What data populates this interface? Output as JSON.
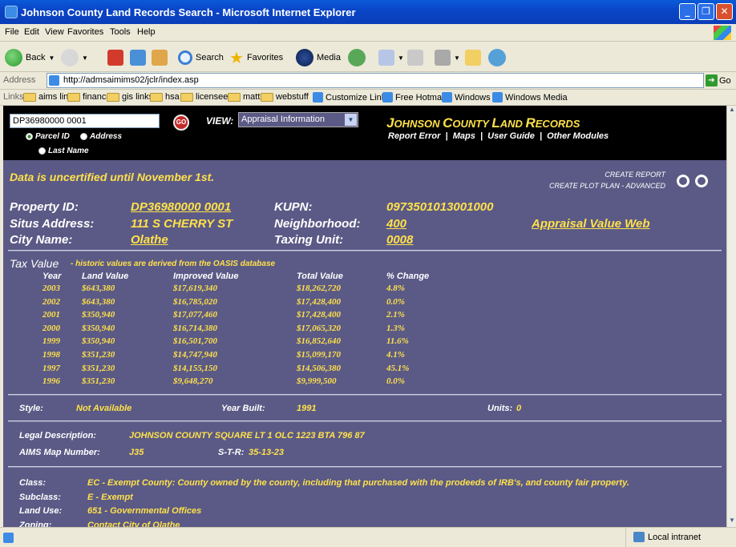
{
  "window": {
    "title": "Johnson County Land Records Search - Microsoft Internet Explorer"
  },
  "menu": [
    "File",
    "Edit",
    "View",
    "Favorites",
    "Tools",
    "Help"
  ],
  "toolbar": {
    "back": "Back",
    "search": "Search",
    "favorites": "Favorites",
    "media": "Media"
  },
  "address": {
    "label": "Address",
    "url": "http://admsaimims02/jclr/index.asp",
    "go": "Go"
  },
  "links": {
    "label": "Links",
    "items": [
      "aims links",
      "finance",
      "gis links",
      "hsa",
      "licensee",
      "matt",
      "webstuff",
      "Customize Links",
      "Free Hotmail",
      "Windows",
      "Windows Media"
    ]
  },
  "search": {
    "parcel_value": "DP36980000 0001",
    "go_label": "GO",
    "radios": [
      "Parcel ID",
      "Address",
      "Last Name"
    ],
    "view_label": "VIEW:",
    "view_selected": "Appraisal Information"
  },
  "brand": {
    "parts": [
      "J",
      "OHNSON ",
      "C",
      "OUNTY ",
      "L",
      "AND ",
      "R",
      "ECORDS"
    ],
    "links": [
      "Report Error",
      "Maps",
      "User Guide",
      "Other Modules"
    ]
  },
  "notice": "Data is uncertified until November 1st.",
  "actions": {
    "create_report": "CREATE REPORT",
    "create_plot_plan": "CREATE PLOT PLAN - ADVANCED"
  },
  "property": {
    "id_label": "Property ID:",
    "id_value": "DP36980000 0001",
    "situs_label": "Situs Address:",
    "situs_value": "111 S CHERRY ST",
    "city_label": "City Name:",
    "city_value": "Olathe",
    "kupn_label": "KUPN:",
    "kupn_value": "0973501013001000",
    "neighborhood_label": "Neighborhood:",
    "neighborhood_value": "400",
    "taxing_label": "Taxing Unit:",
    "taxing_value": "0008",
    "appraisal_link": "Appraisal Value Web"
  },
  "tax": {
    "title": "Tax Value",
    "subtitle": "- historic values are derived from the OASIS database",
    "headers": [
      "Year",
      "Land Value",
      "Improved Value",
      "Total Value",
      "% Change"
    ],
    "rows": [
      [
        "2003",
        "$643,380",
        "$17,619,340",
        "$18,262,720",
        "4.8%"
      ],
      [
        "2002",
        "$643,380",
        "$16,785,020",
        "$17,428,400",
        "0.0%"
      ],
      [
        "2001",
        "$350,940",
        "$17,077,460",
        "$17,428,400",
        "2.1%"
      ],
      [
        "2000",
        "$350,940",
        "$16,714,380",
        "$17,065,320",
        "1.3%"
      ],
      [
        "1999",
        "$350,940",
        "$16,501,700",
        "$16,852,640",
        "11.6%"
      ],
      [
        "1998",
        "$351,230",
        "$14,747,940",
        "$15,099,170",
        "4.1%"
      ],
      [
        "1997",
        "$351,230",
        "$14,155,150",
        "$14,506,380",
        "45.1%"
      ],
      [
        "1996",
        "$351,230",
        "$9,648,270",
        "$9,999,500",
        "0.0%"
      ]
    ]
  },
  "building": {
    "style_label": "Style:",
    "style_value": "Not Available",
    "year_label": "Year Built:",
    "year_value": "1991",
    "units_label": "Units:",
    "units_value": "0"
  },
  "legal": {
    "desc_label": "Legal Description:",
    "desc_value": "JOHNSON COUNTY SQUARE LT 1 OLC 1223 BTA 796 87",
    "map_label": "AIMS Map Number:",
    "map_value": "J35",
    "str_label": "S-T-R:",
    "str_value": "35-13-23"
  },
  "classification": {
    "class_label": "Class:",
    "class_value": "EC - Exempt County: County owned by the county, including that purchased with the prodeeds of IRB's, and county fair property.",
    "subclass_label": "Subclass:",
    "subclass_value": "E - Exempt",
    "landuse_label": "Land Use:",
    "landuse_value": "651 - Governmental Offices",
    "zoning_label": "Zoning:",
    "zoning_value": "Contact City of Olathe"
  },
  "status": {
    "zone": "Local intranet"
  },
  "colors": {
    "content_bg": "#5b5a86",
    "accent_yellow": "#ffe14a",
    "title_blue": "#0a46c8"
  }
}
